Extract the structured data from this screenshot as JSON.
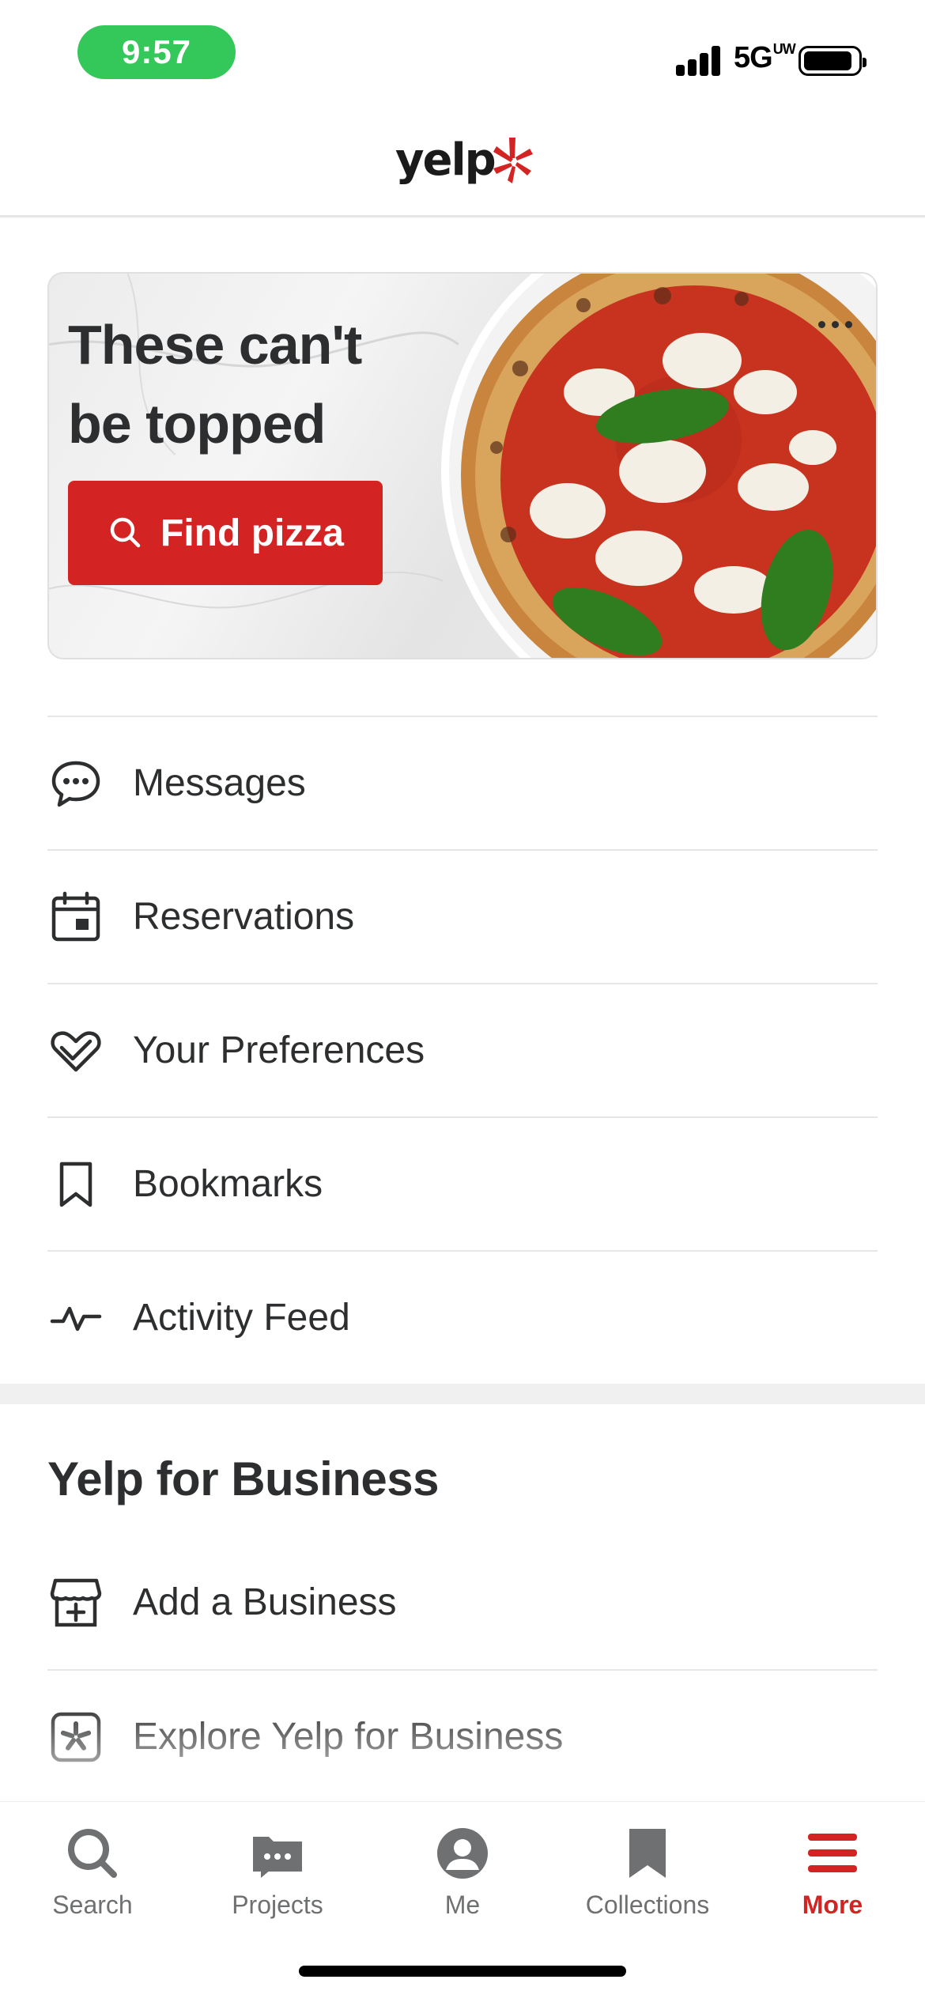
{
  "status_bar": {
    "time": "9:57",
    "network": "5G",
    "network_superscript": "UW"
  },
  "header": {
    "logo_text": "yelp",
    "brand_color": "#d32323"
  },
  "promo": {
    "title_line1": "These can't",
    "title_line2": "be topped",
    "button_label": "Find pizza",
    "button_icon": "search-icon",
    "accent_color": "#d32323"
  },
  "menu": {
    "items": [
      {
        "label": "Messages",
        "icon": "chat-bubble-icon"
      },
      {
        "label": "Reservations",
        "icon": "calendar-icon"
      },
      {
        "label": "Your Preferences",
        "icon": "heart-check-icon"
      },
      {
        "label": "Bookmarks",
        "icon": "bookmark-icon"
      },
      {
        "label": "Activity Feed",
        "icon": "activity-pulse-icon"
      }
    ]
  },
  "business": {
    "title": "Yelp for Business",
    "items": [
      {
        "label": "Add a Business",
        "icon": "storefront-plus-icon"
      },
      {
        "label": "Explore Yelp for Business",
        "icon": "yelp-burst-icon"
      }
    ]
  },
  "tabbar": {
    "tabs": [
      {
        "label": "Search",
        "icon": "search-icon",
        "active": false
      },
      {
        "label": "Projects",
        "icon": "projects-folder-icon",
        "active": false
      },
      {
        "label": "Me",
        "icon": "profile-icon",
        "active": false
      },
      {
        "label": "Collections",
        "icon": "bookmark-filled-icon",
        "active": false
      },
      {
        "label": "More",
        "icon": "hamburger-menu-icon",
        "active": true
      }
    ],
    "inactive_color": "#6e7072",
    "active_color": "#d32323"
  }
}
